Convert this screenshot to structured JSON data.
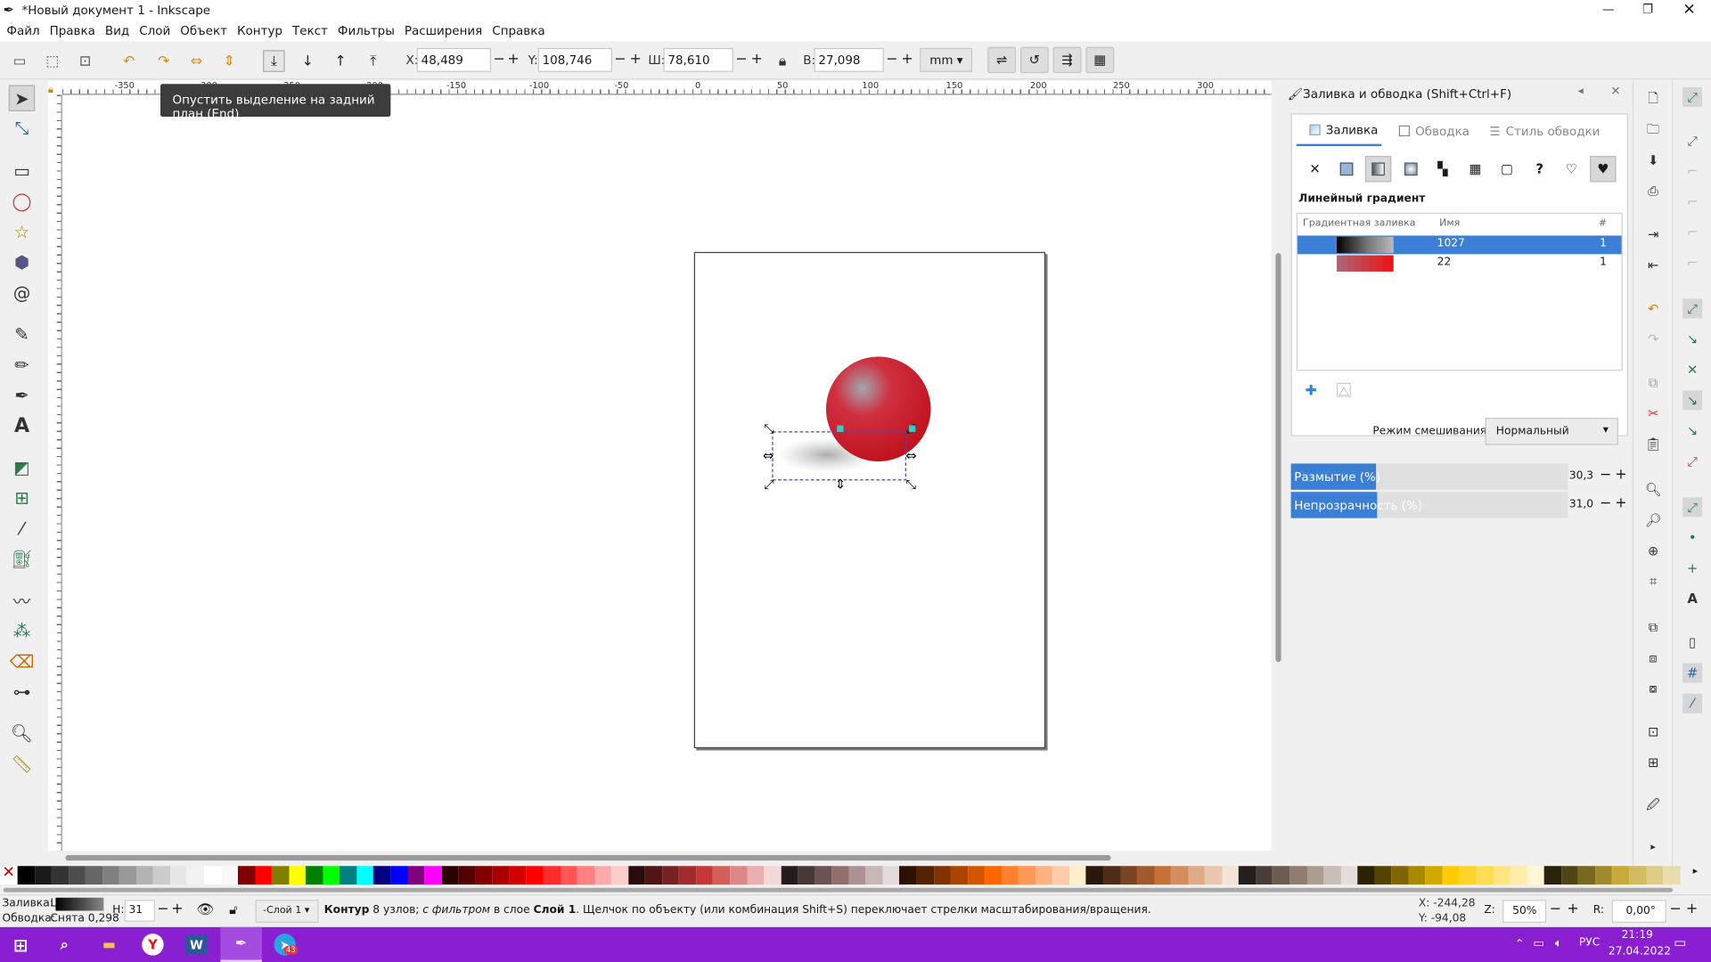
{
  "window": {
    "title": "*Новый документ 1 - Inkscape"
  },
  "menu": [
    "Файл",
    "Правка",
    "Вид",
    "Слой",
    "Объект",
    "Контур",
    "Текст",
    "Фильтры",
    "Расширения",
    "Справка"
  ],
  "toolbar": {
    "x_label": "X:",
    "x_value": "48,489",
    "y_label": "Y:",
    "y_value": "108,746",
    "w_label": "Ш:",
    "w_value": "78,610",
    "h_label": "В:",
    "h_value": "27,098",
    "unit": "mm"
  },
  "tooltip": "Опустить выделение на задний план (End)",
  "ruler_top": [
    "-350",
    "-300",
    "-250",
    "-200",
    "-150",
    "-100",
    "-50",
    "0",
    "50",
    "100",
    "150",
    "200",
    "250",
    "300"
  ],
  "panel": {
    "title": "Заливка и обводка (Shift+Ctrl+F)",
    "tabs": [
      "Заливка",
      "Обводка",
      "Стиль обводки"
    ],
    "section_title": "Линейный градиент",
    "columns": [
      "Градиентная заливка",
      "Имя",
      "#"
    ],
    "gradients": [
      {
        "name": "1027",
        "count": "1",
        "selected": true
      },
      {
        "name": "22",
        "count": "1",
        "selected": false
      }
    ],
    "blend_label": "Режим смешивания:",
    "blend_value": "Нормальный",
    "blur_label": "Размытие (%)",
    "blur_value": "30,3",
    "opacity_label": "Непрозрачность (%)",
    "opacity_value": "31,0"
  },
  "status": {
    "fill_label": "Заливка:",
    "fill_value": "L",
    "stroke_label": "Обводка:",
    "stroke_value": "Снята 0,298",
    "h_label": "Н:",
    "h_value": "31",
    "layer": "-Слой 1",
    "message_bold1": "Контур",
    "message_1": " 8 узлов; ",
    "message_italic": "с фильтром",
    "message_2": " в слое ",
    "message_bold2": "Слой 1",
    "message_3": ". Щелчок по объекту (или комбинация Shift+S) переключает стрелки масштабирования/вращения.",
    "cursor_x": "X: -244,28",
    "cursor_y": "Y: -94,08",
    "zoom_label": "Z:",
    "zoom_value": "50%",
    "rot_label": "R:",
    "rot_value": "0,00°"
  },
  "taskbar": {
    "lang": "РУС",
    "time": "21:19",
    "date": "27.04.2022",
    "telegram_badge": "43"
  },
  "colors": {
    "accent": "#3c7fd6",
    "taskbar": "#8a1fd1",
    "sphere": "#d11a24"
  }
}
